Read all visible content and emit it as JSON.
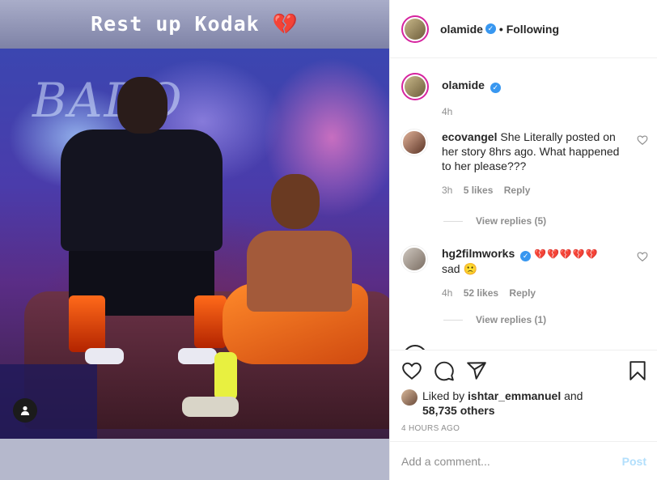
{
  "story": {
    "title": "Rest up Kodak",
    "title_emoji": "💔",
    "sign_text": "BADO"
  },
  "post": {
    "author": "olamide",
    "follow_status": "• Following",
    "more": "···"
  },
  "caption": {
    "username": "olamide",
    "text": "",
    "time": "4h"
  },
  "comments": [
    {
      "username": "ecovangel",
      "text": "She Literally posted on her story 8hrs ago. What happened to her please???",
      "time": "3h",
      "likes": "5 likes",
      "reply": "Reply",
      "view_replies": "View replies (5)"
    },
    {
      "username": "hg2filmworks",
      "emojis": "💔💔💔💔💔",
      "text": "sad 🙁",
      "time": "4h",
      "likes": "52 likes",
      "reply": "Reply",
      "view_replies": "View replies (1)"
    }
  ],
  "likes": {
    "prefix": "Liked by",
    "user": "ishtar_emmanuel",
    "and": "and",
    "others": "58,735 others"
  },
  "timestamp": "4 HOURS AGO",
  "add_comment": {
    "placeholder": "Add a comment...",
    "post_label": "Post"
  },
  "icons": [
    "heart-icon",
    "comment-icon",
    "share-icon",
    "bookmark-icon",
    "user-tag-icon",
    "verified-icon"
  ],
  "colors": {
    "accent": "#3897f0",
    "post_button": "#b2dffc",
    "broken_heart": "#d0021b",
    "story_ring": "#d6249f"
  }
}
